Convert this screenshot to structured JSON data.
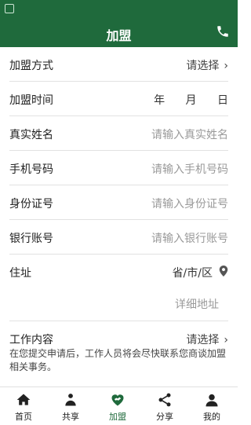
{
  "header": {
    "title": "加盟"
  },
  "form": {
    "join_method": {
      "label": "加盟方式",
      "value": "请选择"
    },
    "join_time": {
      "label": "加盟时间",
      "year": "年",
      "month": "月",
      "day": "日"
    },
    "real_name": {
      "label": "真实姓名",
      "placeholder": "请输入真实姓名"
    },
    "phone": {
      "label": "手机号码",
      "placeholder": "请输入手机号码"
    },
    "id_number": {
      "label": "身份证号",
      "placeholder": "请输入身份证号"
    },
    "bank_account": {
      "label": "银行账号",
      "placeholder": "请输入银行账号"
    },
    "address": {
      "label": "住址",
      "region": "省/市/区",
      "detail_placeholder": "详细地址"
    },
    "work_content": {
      "label": "工作内容",
      "value": "请选择"
    }
  },
  "notice": "在您提交申请后，工作人员将会尽快联系您商谈加盟相关事务。",
  "tabs": [
    {
      "label": "首页",
      "icon": "home-icon"
    },
    {
      "label": "共享",
      "icon": "share-person-icon"
    },
    {
      "label": "加盟",
      "icon": "handshake-heart-icon",
      "active": true
    },
    {
      "label": "分享",
      "icon": "share-nodes-icon"
    },
    {
      "label": "我的",
      "icon": "user-icon"
    }
  ],
  "colors": {
    "brand": "#1f6a3c",
    "placeholder": "#9a9a9a",
    "divider": "#e2e2e2"
  }
}
